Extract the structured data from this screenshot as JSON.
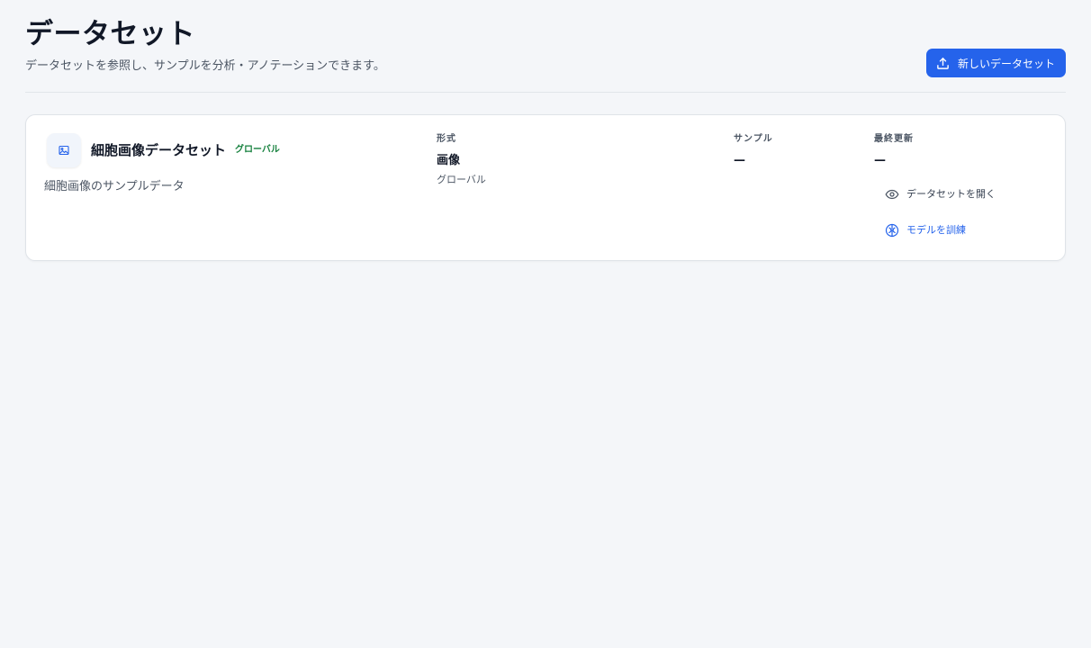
{
  "header": {
    "title": "データセット",
    "subtitle": "データセットを参照し、サンプルを分析・アノテーションできます。",
    "new_button_label": "新しいデータセット",
    "new_button_icon": "upload-icon"
  },
  "colors": {
    "accent": "#2563eb",
    "badge_green": "#15803d",
    "background": "#f4f6f9"
  },
  "datasets": [
    {
      "thumbnail_icon": "image-icon",
      "name": "細胞画像データセット",
      "badge": "グローバル",
      "description": "細胞画像のサンプルデータ",
      "format_label": "形式",
      "format_value": "画像",
      "format_sub": "グローバル",
      "samples_label": "サンプル",
      "samples_value": "—",
      "updated_label": "最終更新",
      "updated_value": "—",
      "actions": {
        "open_label": "データセットを開く",
        "open_icon": "eye-icon",
        "train_label": "モデルを訓練",
        "train_icon": "brain-icon"
      }
    }
  ]
}
